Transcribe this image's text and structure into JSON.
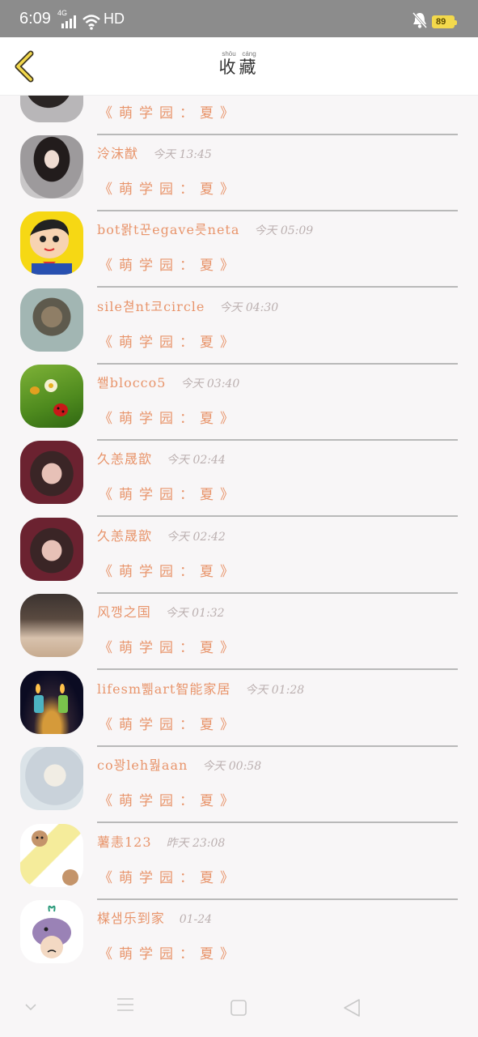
{
  "status_bar": {
    "time": "6:09",
    "network": "4G",
    "hd": "HD",
    "battery": "89",
    "colors": {
      "background": "#8c8c8c",
      "battery": "#f3d94c"
    }
  },
  "header": {
    "title": "收藏",
    "title_pinyin": [
      "shōu",
      "cáng"
    ],
    "back_icon": "chevron-left-icon"
  },
  "list": {
    "items": [
      {
        "name": "",
        "time": "",
        "subtitle": "《萌学园：夏》"
      },
      {
        "name": "泠沫猷",
        "time": "今天 13:45",
        "subtitle": "《萌学园：夏》"
      },
      {
        "name": "bot뫍t꾼egave릇neta",
        "time": "今天 05:09",
        "subtitle": "《萌学园：夏》"
      },
      {
        "name": "sile쳗nt코circle",
        "time": "今天 04:30",
        "subtitle": "《萌学园：夏》"
      },
      {
        "name": "쐘blocco5",
        "time": "今天 03:40",
        "subtitle": "《萌学园：夏》"
      },
      {
        "name": "久恙晟歆",
        "time": "今天 02:44",
        "subtitle": "《萌学园：夏》"
      },
      {
        "name": "久恙晟歆",
        "time": "今天 02:42",
        "subtitle": "《萌学园：夏》"
      },
      {
        "name": "风깽之国",
        "time": "今天 01:32",
        "subtitle": "《萌学园：夏》"
      },
      {
        "name": "lifesm쀎art智能家居",
        "time": "今天 01:28",
        "subtitle": "《萌学园：夏》"
      },
      {
        "name": "co꽝leh뭞aan",
        "time": "今天 00:58",
        "subtitle": "《萌学园：夏》"
      },
      {
        "name": "薯恚123",
        "time": "昨天 23:08",
        "subtitle": "《萌学园：夏》"
      },
      {
        "name": "楳샘乐到家",
        "time": "01-24",
        "subtitle": "《萌学园：夏》"
      }
    ]
  },
  "nav_bar": {
    "icons": [
      "chevron-down-icon",
      "menu-icon",
      "home-square-icon",
      "back-triangle-icon"
    ]
  },
  "colors": {
    "accent": "#e8956c",
    "time": "#bbb0b0",
    "divider": "#b9b9b9",
    "background": "#f8f6f7"
  }
}
